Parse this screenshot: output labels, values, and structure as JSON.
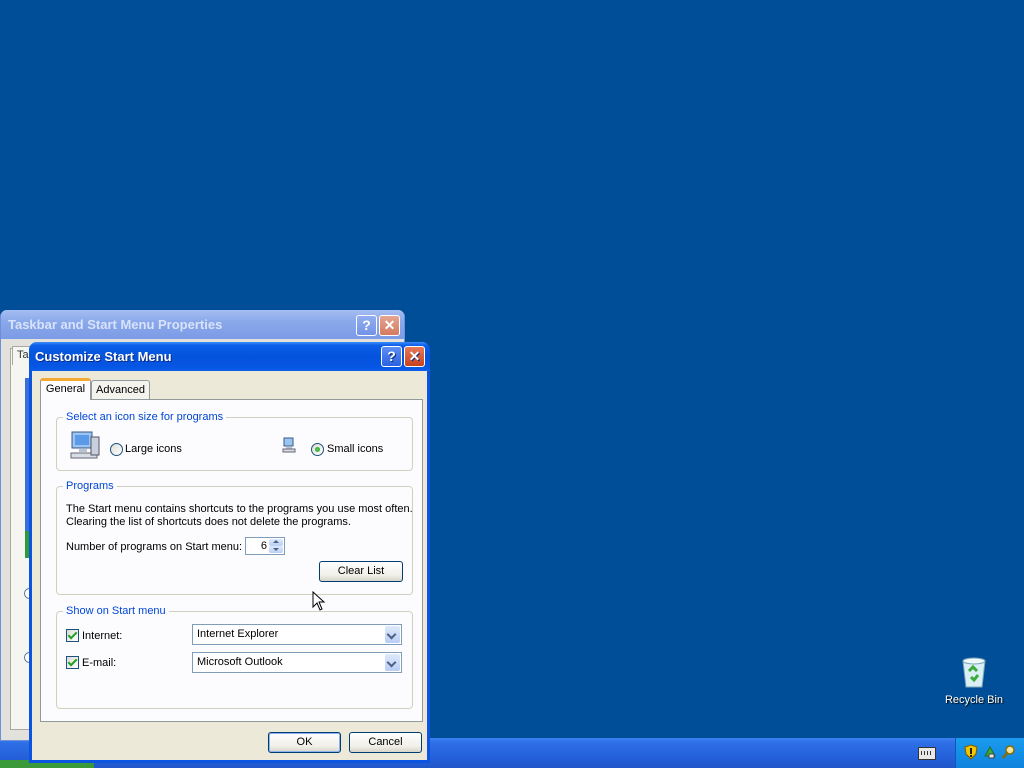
{
  "desktop": {
    "recycle_bin_label": "Recycle Bin"
  },
  "back_window": {
    "title": "Taskbar and Start Menu Properties",
    "tab_stub": "Ta"
  },
  "dialog": {
    "title": "Customize Start Menu",
    "help_glyph": "?",
    "close_glyph": "✕",
    "tabs": [
      "General",
      "Advanced"
    ],
    "active_tab": "General",
    "icon_size": {
      "group_label": "Select an icon size for programs",
      "large_label": "Large icons",
      "small_label": "Small icons",
      "selected": "Small icons"
    },
    "programs": {
      "group_label": "Programs",
      "description_line1": "The Start menu contains shortcuts to the programs you use most often.",
      "description_line2": "Clearing the list of shortcuts does not delete the programs.",
      "count_label": "Number of programs on Start menu:",
      "count_value": "6",
      "clear_list_label": "Clear List"
    },
    "show_on_start": {
      "group_label": "Show on Start menu",
      "internet_label": "Internet:",
      "internet_checked": true,
      "internet_value": "Internet Explorer",
      "email_label": "E-mail:",
      "email_checked": true,
      "email_value": "Microsoft Outlook"
    },
    "ok_label": "OK",
    "cancel_label": "Cancel"
  },
  "colors": {
    "desktop": "#004e98",
    "title_active": "#0553dc",
    "group_label": "#0046d5",
    "check_green": "#21a121"
  }
}
